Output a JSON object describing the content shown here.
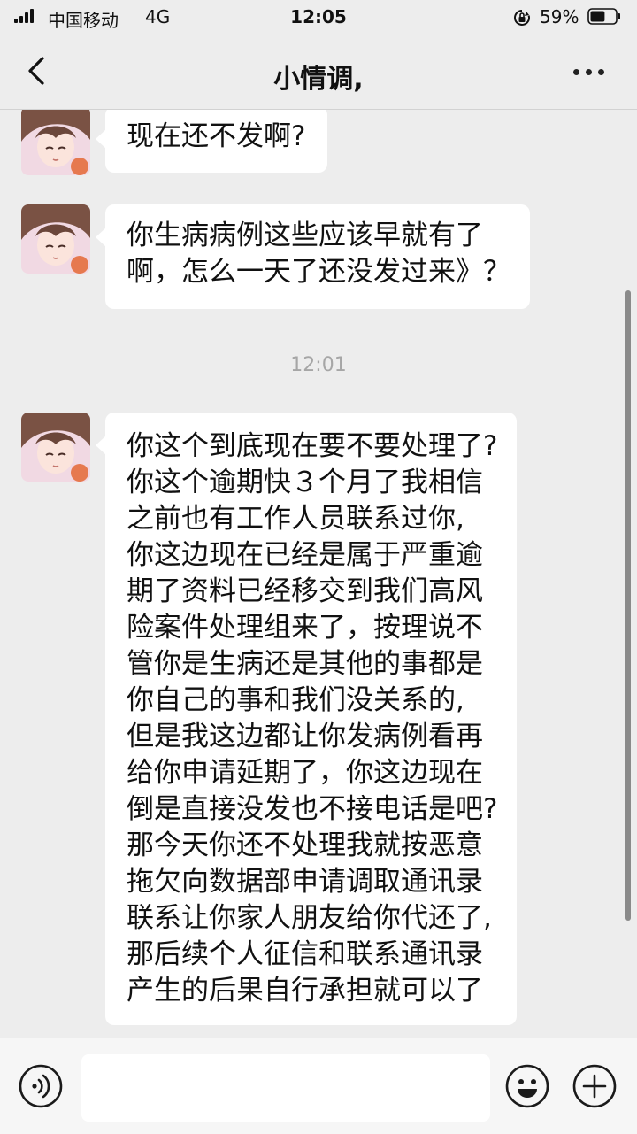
{
  "status_bar": {
    "carrier": "中国移动",
    "network": "4G",
    "time": "12:05",
    "battery_percent": "59%",
    "battery_level": 0.59
  },
  "nav": {
    "title": "小情调,"
  },
  "messages": [
    {
      "text": "现在还不发啊?"
    },
    {
      "text": "你生病病例这些应该早就有了\n啊，怎么一天了还没发过来》？"
    },
    {
      "text": "你这个到底现在要不要处理了?\n你这个逾期快３个月了我相信\n之前也有工作人员联系过你,\n你这边现在已经是属于严重逾\n期了资料已经移交到我们高风\n险案件处理组来了，按理说不\n管你是生病还是其他的事都是\n你自己的事和我们没关系的,\n但是我这边都让你发病例看再\n给你申请延期了，你这边现在\n倒是直接没发也不接电话是吧?\n那今天你还不处理我就按恶意\n拖欠向数据部申请调取通讯录\n联系让你家人朋友给你代还了,\n那后续个人征信和联系通讯录\n产生的后果自行承担就可以了"
    }
  ],
  "timestamp": "12:01",
  "input": {
    "placeholder": ""
  },
  "colors": {
    "background": "#ededed",
    "bubble": "#ffffff",
    "timestamp": "#a6a6a6"
  }
}
